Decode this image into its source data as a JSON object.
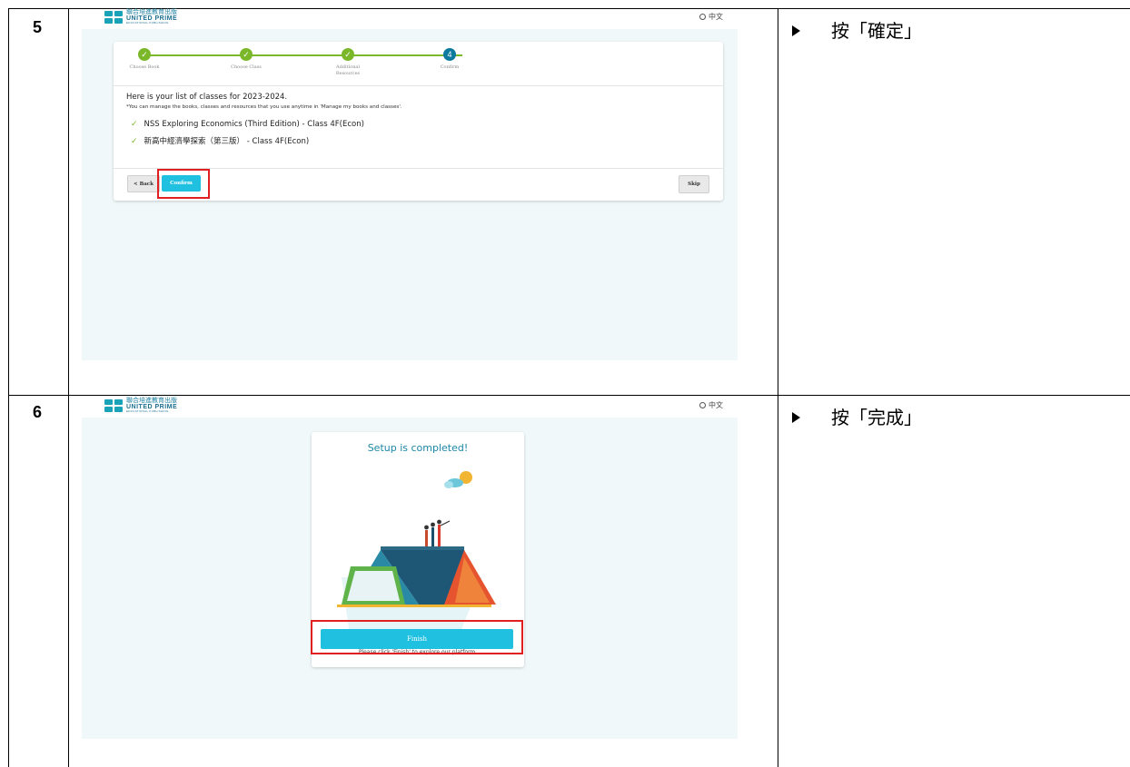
{
  "rows": [
    {
      "step": "5",
      "instruction": "按「確定」",
      "screen": {
        "lang_label": "中文",
        "logo": {
          "zh": "聯合培進教育出版",
          "en": "UNITED PRIME",
          "sub": "EDUCATIONAL PUBLISHING"
        },
        "stepper": [
          {
            "label": "Choose Book",
            "state": "done",
            "mark": "✓"
          },
          {
            "label": "Choose Class",
            "state": "done",
            "mark": "✓"
          },
          {
            "label": "Additional\nResources",
            "state": "done",
            "mark": "✓"
          },
          {
            "label": "Confirm",
            "state": "active",
            "mark": "4"
          }
        ],
        "heading": "Here is your list of classes for 2023-2024.",
        "note": "*You can manage the books, classes and resources that you use anytime in 'Manage my books and classes'.",
        "classes": [
          "NSS Exploring Economics (Third Edition) - Class 4F(Econ)",
          "新高中經濟學探索（第三版） - Class 4F(Econ)"
        ],
        "back_label": "< Back",
        "confirm_label": "Confirm",
        "skip_label": "Skip"
      }
    },
    {
      "step": "6",
      "instruction": "按「完成」",
      "screen": {
        "lang_label": "中文",
        "logo": {
          "zh": "聯合培進教育出版",
          "en": "UNITED PRIME",
          "sub": "EDUCATIONAL PUBLISHING"
        },
        "title": "Setup is completed!",
        "hint": "Please click 'Finish' to explore our platform.",
        "finish_label": "Finish"
      }
    }
  ],
  "colors": {
    "accent": "#1fc0e0",
    "done": "#7ab829",
    "active": "#0b7a9c",
    "highlight": "#e02020",
    "app_bg": "#f1f8fa"
  }
}
